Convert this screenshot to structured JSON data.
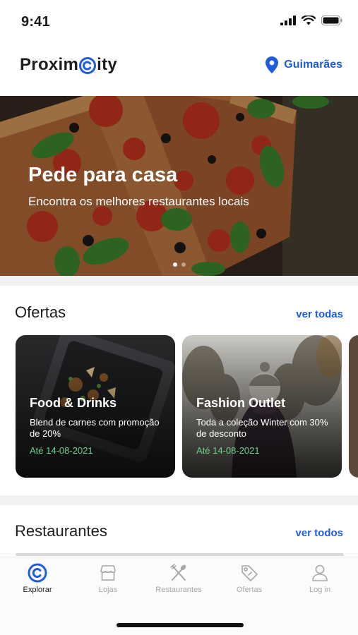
{
  "status_bar": {
    "time": "9:41"
  },
  "header": {
    "brand_left": "Proxim",
    "brand_right": "ity",
    "brand_mark_icon": "c-logo-icon",
    "location_icon": "map-pin-icon",
    "location": "Guimarães"
  },
  "hero": {
    "title": "Pede para casa",
    "subtitle": "Encontra os melhores restaurantes locais",
    "slides": 2,
    "active_slide": 1
  },
  "offers": {
    "title": "Ofertas",
    "see_all": "ver todas",
    "cards": [
      {
        "title": "Food & Drinks",
        "description": "Blend de carnes com promoção de 20%",
        "date": "Até 14-08-2021"
      },
      {
        "title": "Fashion Outlet",
        "description": "Toda a coleção Winter com 30% de desconto",
        "date": "Até 14-08-2021"
      }
    ]
  },
  "restaurants": {
    "title": "Restaurantes",
    "see_all": "ver todos"
  },
  "tabs": [
    {
      "label": "Explorar",
      "icon": "compass-c-icon",
      "active": true
    },
    {
      "label": "Lojas",
      "icon": "store-icon",
      "active": false
    },
    {
      "label": "Restaurantes",
      "icon": "fork-knife-icon",
      "active": false
    },
    {
      "label": "Ofertas",
      "icon": "tag-icon",
      "active": false
    },
    {
      "label": "Log in",
      "icon": "user-icon",
      "active": false
    }
  ],
  "colors": {
    "accent": "#1f5ddb",
    "date_green": "#6fd08c",
    "tab_inactive": "#a7a7ad",
    "section_bg": "#f2f2f4"
  }
}
